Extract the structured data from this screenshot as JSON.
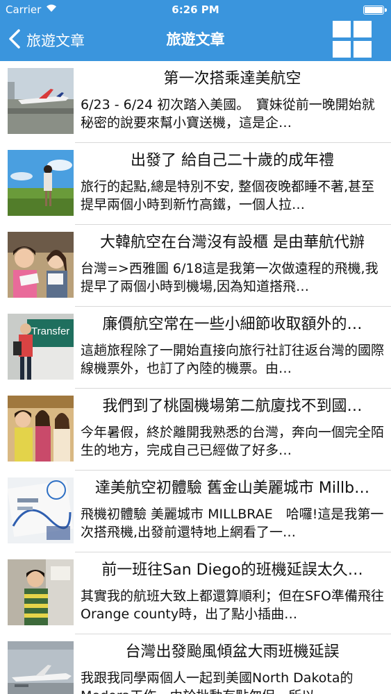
{
  "status_bar": {
    "carrier": "Carrier",
    "time": "6:26 PM",
    "wifi_icon": "wifi-icon",
    "battery_icon": "battery-icon"
  },
  "nav": {
    "back_label": "旅遊文章",
    "title": "旅遊文章",
    "menu_icon": "grid-icon"
  },
  "colors": {
    "nav_background": "#3a95dd",
    "text": "#111111",
    "separator": "#d8d8d8"
  },
  "articles": [
    {
      "title": "第一次搭乘達美航空",
      "excerpt": "6/23 - 6/24 初次踏入美國。　寶妹從前一晚開始就秘密的說要來幫小寶送機，這是企…",
      "thumb": "airplane-on-runway"
    },
    {
      "title": "出發了 給自己二十歲的成年禮",
      "excerpt": "旅行的起點,總是特別不安, 整個夜晚都睡不著,甚至提早兩個小時到新竹高鐵，一個人拉…",
      "thumb": "person-in-field"
    },
    {
      "title": "大韓航空在台灣沒有設櫃 是由華航代辦",
      "excerpt": "台灣=>西雅圖 6/18這是我第一次做遠程的飛機,我提早了兩個小時到機場,因為知道搭飛…",
      "thumb": "friends-with-tickets"
    },
    {
      "title": "廉價航空常在一些小細節收取額外的…",
      "excerpt": "這趟旅程除了一開始直接向旅行社訂往返台灣的國際線機票外，也訂了內陸的機票。由…",
      "thumb": "transfer-sign"
    },
    {
      "title": "我們到了桃園機場第二航廈找不到國…",
      "excerpt": "今年暑假，終於離開我熟悉的台灣，奔向一個完全陌生的地方，完成自己已經做了好多…",
      "thumb": "group-at-airport"
    },
    {
      "title": "達美航空初體驗 舊金山美麗城市 Millb…",
      "excerpt": "飛機初體驗 美麗城市 MILLBRAE　哈囉!這是我第一次搭飛機,出發前還特地上網看了一…",
      "thumb": "boarding-pass"
    },
    {
      "title": "前一班往San Diego的班機延誤太久…",
      "excerpt": "其實我的航班大致上都還算順利；但在SFO準備飛往Orange county時，出了點小插曲…",
      "thumb": "man-at-gate"
    },
    {
      "title": "台灣出發颱風傾盆大雨班機延誤",
      "excerpt": "我跟我同學兩個人一起到美國North Dakota的Medora工作，由於批動有點匆促，所以…",
      "thumb": "plane-in-rain"
    }
  ]
}
